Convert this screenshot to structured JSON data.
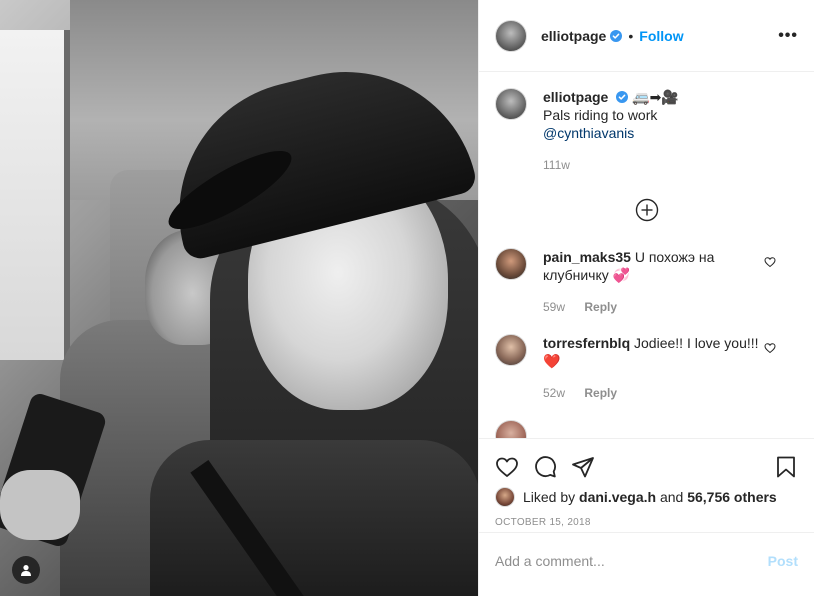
{
  "header": {
    "username": "elliotpage",
    "separator": "•",
    "follow_label": "Follow",
    "more_label": "•••"
  },
  "caption": {
    "username": "elliotpage",
    "emoji": "🚐➡🎥",
    "text": "Pals riding to work",
    "mention": "@cynthiavanis",
    "time": "111w"
  },
  "comments": [
    {
      "username": "pain_maks35",
      "text": "U похожэ на клубничку 💞",
      "time": "59w",
      "reply_label": "Reply"
    },
    {
      "username": "torresfernblq",
      "text": "Jodiee!! I love you!!! ❤️",
      "time": "52w",
      "reply_label": "Reply"
    }
  ],
  "likes": {
    "prefix": "Liked by",
    "user": "dani.vega.h",
    "and": "and",
    "count": "56,756 others"
  },
  "date": "OCTOBER 15, 2018",
  "comment_input": {
    "placeholder": "Add a comment...",
    "post_label": "Post"
  },
  "colors": {
    "accent": "#0095f6",
    "post_disabled": "#b2dffc",
    "muted": "#8e8e8e",
    "mention": "#00376b"
  }
}
